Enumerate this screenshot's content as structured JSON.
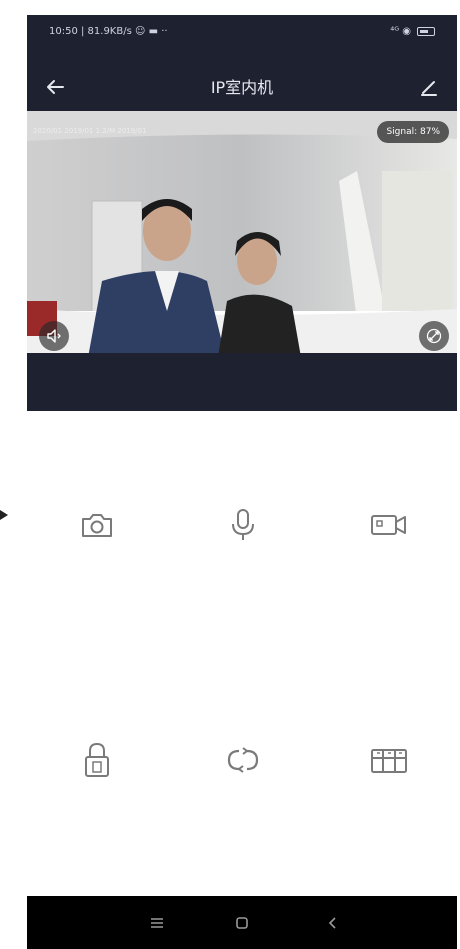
{
  "status_bar": {
    "left_text": "10:50 | 81.9KB/s ☺ ▬ ··",
    "right_text": "⁴ᴳ ◉"
  },
  "app_bar": {
    "title": "IP室内机",
    "back_icon": "back-arrow-icon",
    "edit_icon": "edit-pencil-icon"
  },
  "video": {
    "info_text": "2020/01 2019/01 1.2/M 2019/01",
    "signal_label": "Signal: 87%",
    "mute_icon": "speaker-icon",
    "fullscreen_icon": "fullscreen-icon"
  },
  "controls": {
    "row1": [
      "camera-icon",
      "microphone-icon",
      "video-record-icon"
    ],
    "row2": [
      "unlock-icon",
      "refresh-icon",
      "gallery-icon"
    ]
  },
  "nav_bar": {
    "menu_icon": "menu-icon",
    "home_icon": "home-icon",
    "back_icon": "back-chevron-icon"
  },
  "colors": {
    "header_bg": "#1e2230",
    "icon_gray": "#7a7a7a",
    "nav_bg": "#000000"
  }
}
